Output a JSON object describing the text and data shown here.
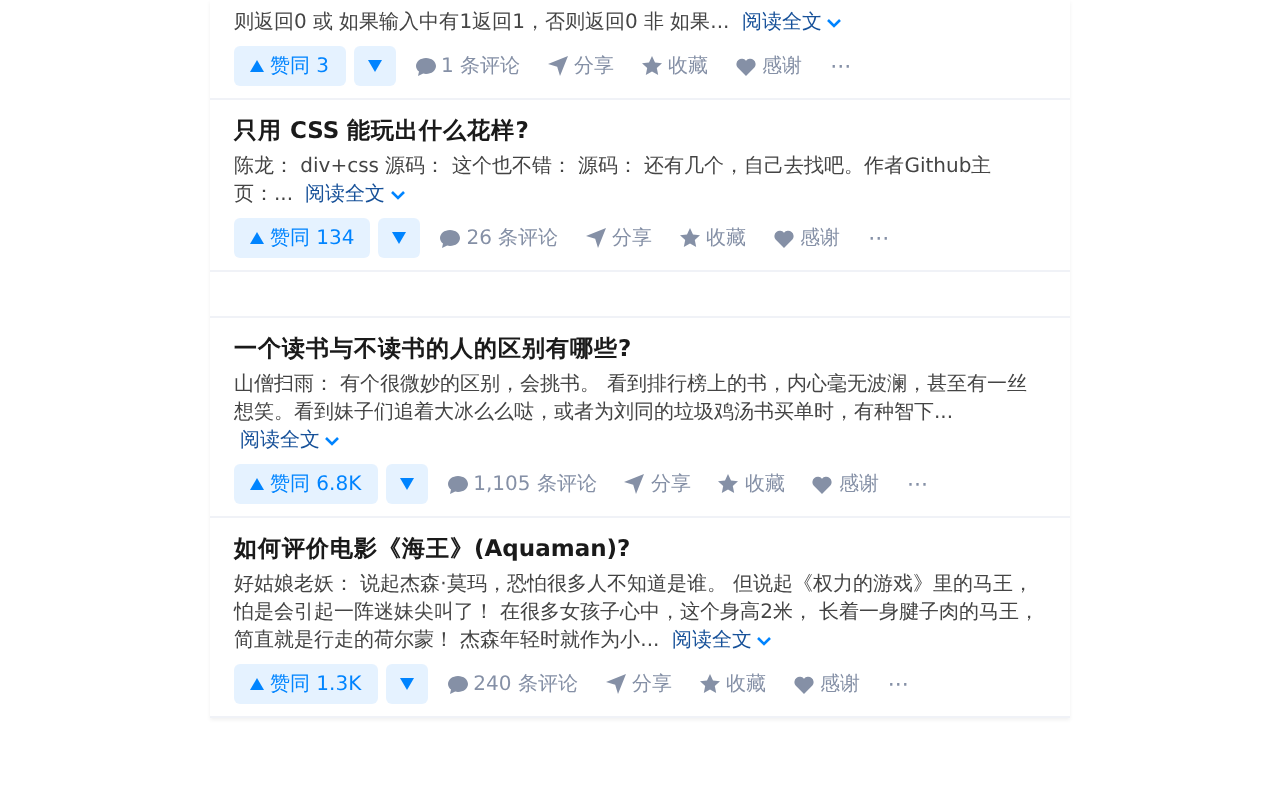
{
  "feed": [
    {
      "excerpt": "则返回0 或 如果输入中有1返回1，否则返回0 非 如果...",
      "read_more": "阅读全文",
      "vote": "赞同 3",
      "comments": "1 条评论",
      "share": "分享",
      "favorite": "收藏",
      "thanks": "感谢",
      "more": "···"
    },
    {
      "title": "只用 CSS 能玩出什么花样?",
      "excerpt": "陈龙： div+css 源码： 这个也不错： 源码： 还有几个，自己去找吧。作者Github主页：...",
      "read_more": "阅读全文",
      "vote": "赞同 134",
      "comments": "26 条评论",
      "share": "分享",
      "favorite": "收藏",
      "thanks": "感谢",
      "more": "···"
    },
    {
      "kind": "spacer"
    },
    {
      "title": "一个读书与不读书的人的区别有哪些?",
      "excerpt": "山僧扫雨： 有个很微妙的区别，会挑书。 看到排行榜上的书，内心毫无波澜，甚至有一丝想笑。看到妹子们追着大冰么么哒，或者为刘同的垃圾鸡汤书买单时，有种智下...",
      "read_more": "阅读全文",
      "vote": "赞同 6.8K",
      "comments": "1,105 条评论",
      "share": "分享",
      "favorite": "收藏",
      "thanks": "感谢",
      "more": "···"
    },
    {
      "title": "如何评价电影《海王》(Aquaman)?",
      "excerpt": "好姑娘老妖： 说起杰森·莫玛，恐怕很多人不知道是谁。 但说起《权力的游戏》里的马王，怕是会引起一阵迷妹尖叫了！ 在很多女孩子心中，这个身高2米， 长着一身腱子肉的马王，简直就是行走的荷尔蒙！ 杰森年轻时就作为小...",
      "read_more": "阅读全文",
      "vote": "赞同 1.3K",
      "comments": "240 条评论",
      "share": "分享",
      "favorite": "收藏",
      "thanks": "感谢",
      "more": "···"
    }
  ]
}
